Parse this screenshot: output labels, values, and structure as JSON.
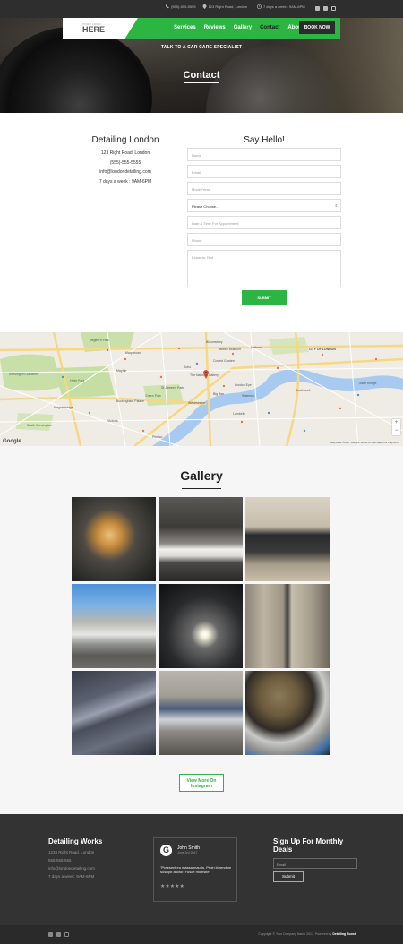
{
  "topbar": {
    "phone": "(555)-555-5555",
    "address": "123 Right Road, London",
    "hours": "7 days a week : 9AM-6PM",
    "social": [
      "facebook-icon",
      "yelp-icon",
      "instagram-icon"
    ]
  },
  "nav": {
    "logo_small": "YOUR LOGO",
    "logo_big": "HERE",
    "links": [
      "Services",
      "Reviews",
      "Gallery",
      "Contact",
      "About"
    ],
    "book": "BOOK NOW"
  },
  "hero": {
    "subtitle": "TALK TO A CAR CARE SPECIALIST",
    "title": "Contact"
  },
  "contact": {
    "business_name": "Detailing London",
    "address": "123 Right Road, London",
    "phone": "(555)-555-5555",
    "email": "info@londondetailing.com",
    "hours": "7 days a week : 9AM-6PM"
  },
  "form": {
    "title": "Say Hello!",
    "name_placeholder": "Name",
    "email_placeholder": "Email",
    "model_placeholder": "Model/Year",
    "select_value": "Please Choose...",
    "datetime_placeholder": "Date & Time For Appointment",
    "phone_placeholder": "Phone",
    "message_placeholder": "Example Text",
    "submit": "SUBMIT"
  },
  "map": {
    "attribution": "Map data ©2017 Google   Terms of Use   Report a map error",
    "google": "Google",
    "labels": [
      "Regent's Park",
      "Hyde Park",
      "Kensington Gardens",
      "Green Park",
      "St James's Park",
      "Mayfair",
      "Marylebone",
      "Soho",
      "Covent Garden",
      "CITY OF LONDON",
      "Southwark",
      "Lambeth",
      "Westminster",
      "Tower Bridge",
      "Waterloo",
      "The National Gallery",
      "Knightsbridge",
      "South Kensington",
      "Holborn",
      "Bloomsbury",
      "British Museum",
      "London Eye",
      "Big Ben",
      "Buckingham Palace",
      "Victoria",
      "Pimlico"
    ]
  },
  "gallery": {
    "title": "Gallery",
    "more": "View More On Instagram"
  },
  "footer": {
    "col1_title": "Detailing Works",
    "col1_lines": [
      "1234 Right Road, London",
      "555-555-555",
      "info@londondetailing.com",
      "7 days a week: 9AM-6PM"
    ],
    "review_name": "John Smith",
    "review_date": "June 3rd 2017",
    "review_text": "\"Praesent eu massa mauris. Proin bibendum suscipit auctor. Fusce molestie\"",
    "review_stars": "★★★★★",
    "newsletter_title": "Sign Up For Monthly Deals",
    "email_placeholder": "Email",
    "submit": "Submit",
    "copyright_prefix": "Copyright © Your Company Name 2017. Powered by ",
    "copyright_brand": "Detailing Boost."
  },
  "colors": {
    "accent": "#2db543",
    "dark": "#333333"
  }
}
